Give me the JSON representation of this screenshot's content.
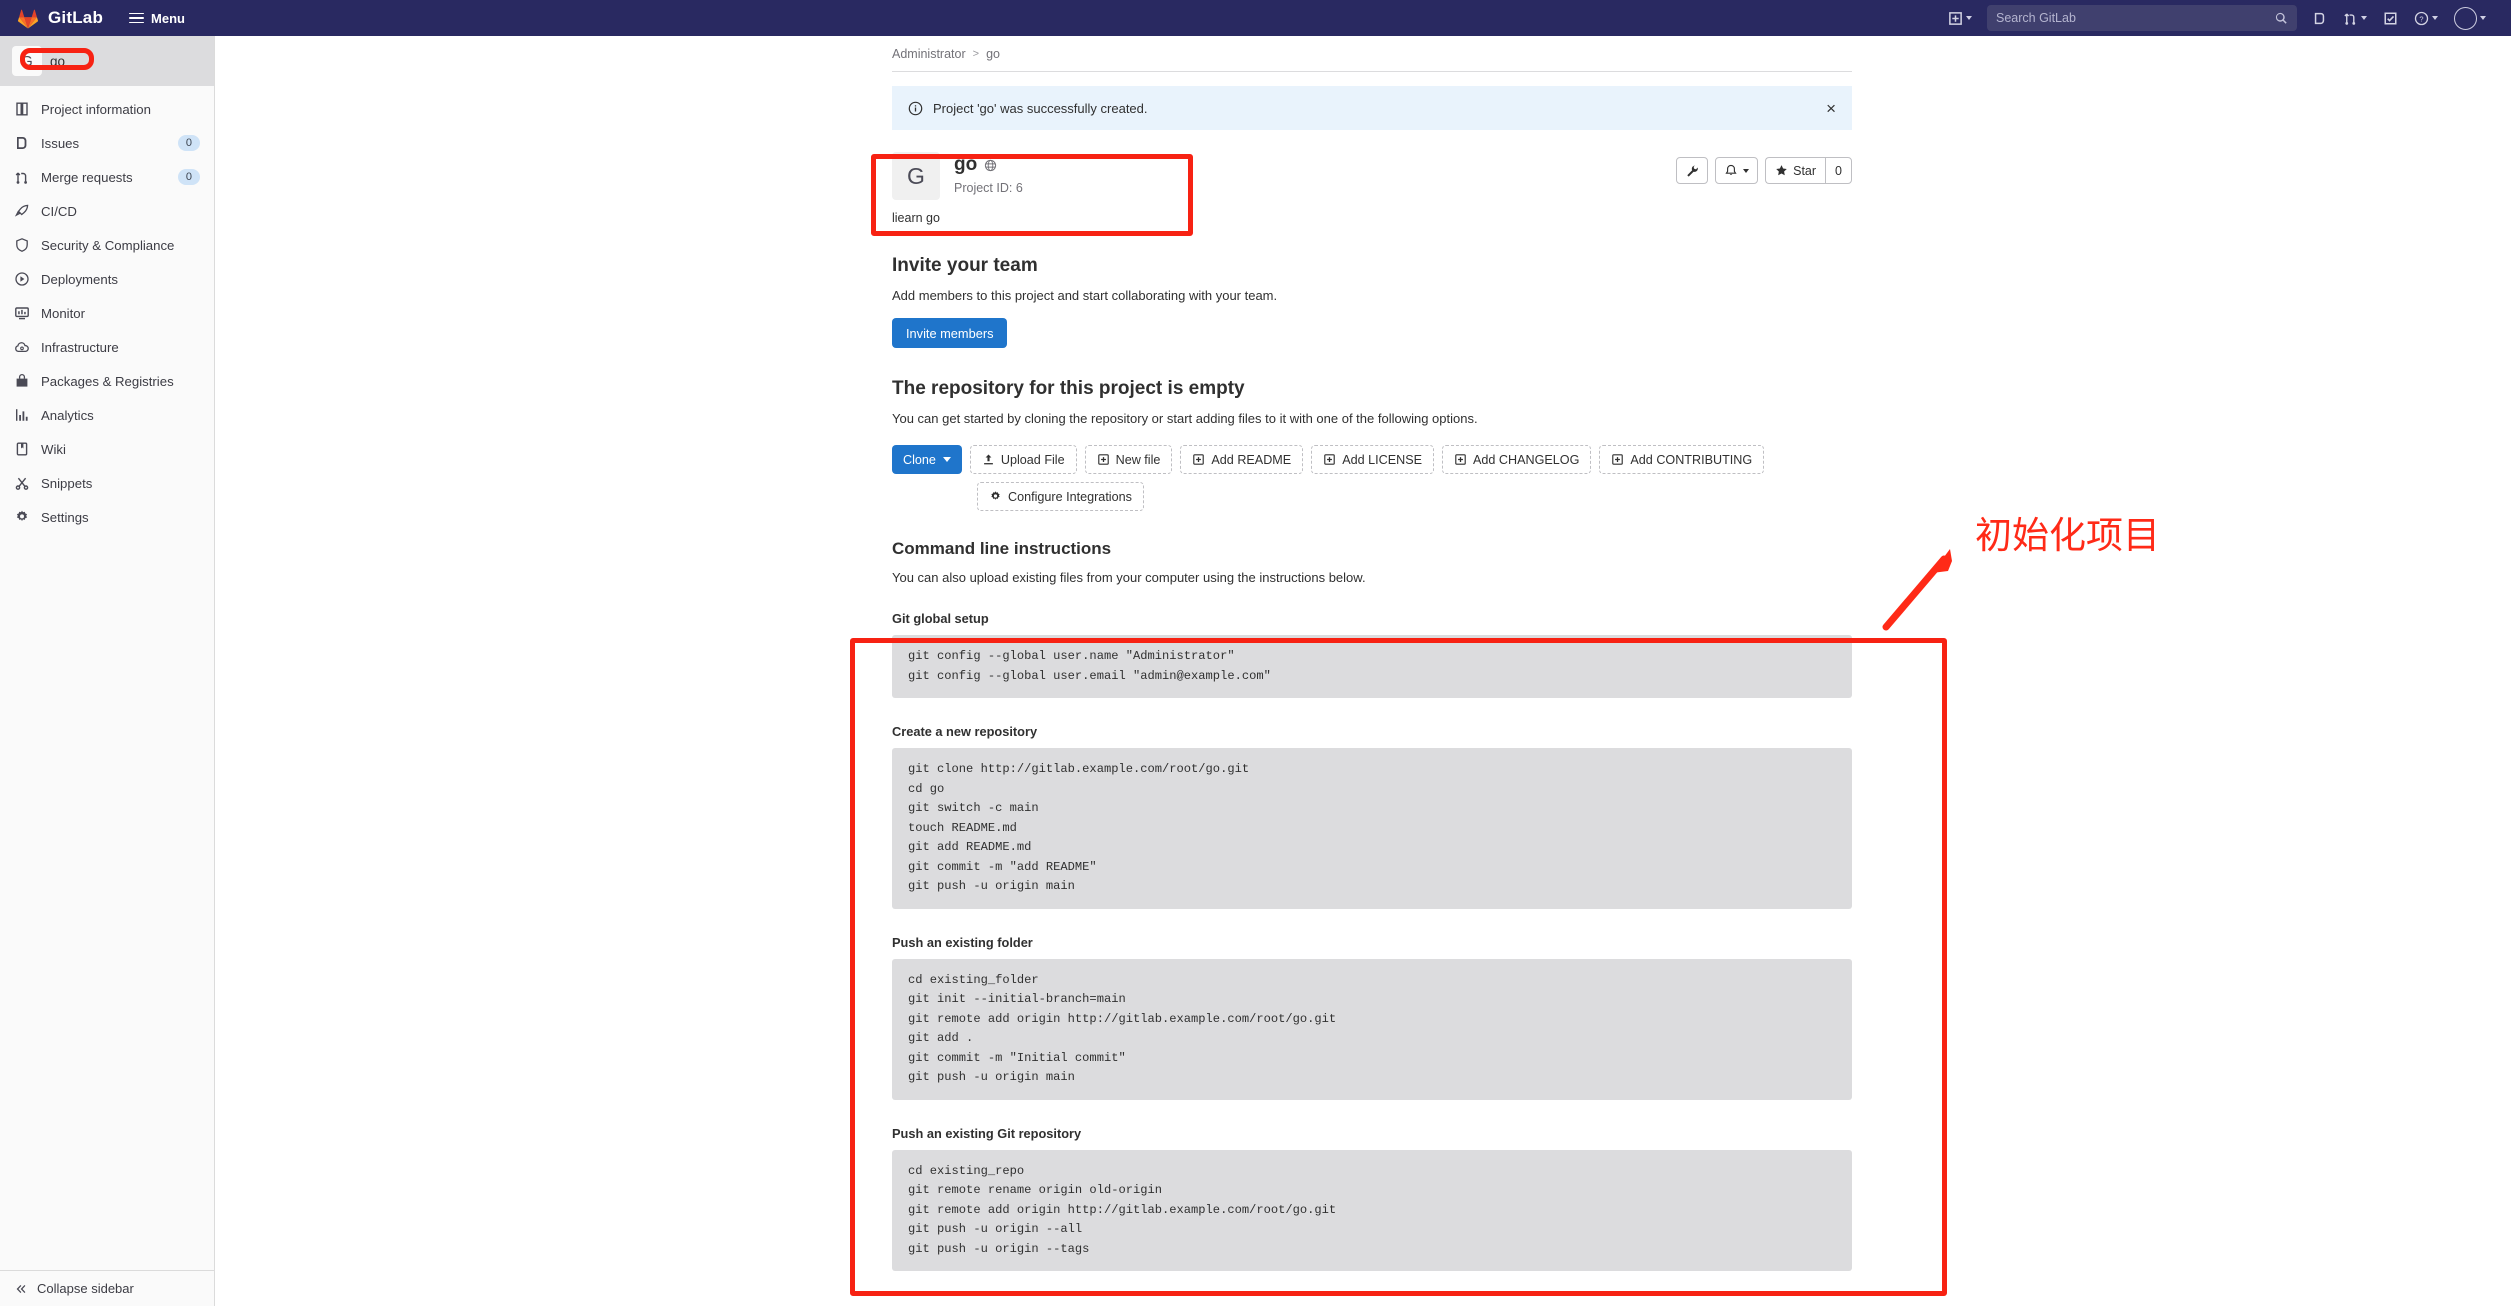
{
  "topnav": {
    "brand": "GitLab",
    "menu_label": "Menu",
    "brand_icon": "gitlab-logo-icon",
    "plus_icon": "plus-square-icon",
    "search_placeholder": "Search GitLab",
    "search_value": "",
    "search_icon": "search-icon",
    "issues_icon": "issues-icon",
    "merge_requests_icon": "merge-request-icon",
    "todos_icon": "todo-checkbox-icon",
    "help_icon": "question-circle-icon",
    "avatar_icon": "user-avatar-icon"
  },
  "sidebar": {
    "project": {
      "avatar_letter": "G",
      "name": "go"
    },
    "items": [
      {
        "label": "Project information",
        "icon": "project-information-icon",
        "badge": ""
      },
      {
        "label": "Issues",
        "icon": "issues-icon",
        "badge": "0"
      },
      {
        "label": "Merge requests",
        "icon": "merge-request-icon",
        "badge": "0"
      },
      {
        "label": "CI/CD",
        "icon": "rocket-icon",
        "badge": ""
      },
      {
        "label": "Security & Compliance",
        "icon": "shield-icon",
        "badge": ""
      },
      {
        "label": "Deployments",
        "icon": "deployments-icon",
        "badge": ""
      },
      {
        "label": "Monitor",
        "icon": "monitor-icon",
        "badge": ""
      },
      {
        "label": "Infrastructure",
        "icon": "cloud-gear-icon",
        "badge": ""
      },
      {
        "label": "Packages & Registries",
        "icon": "package-icon",
        "badge": ""
      },
      {
        "label": "Analytics",
        "icon": "chart-bar-icon",
        "badge": ""
      },
      {
        "label": "Wiki",
        "icon": "book-icon",
        "badge": ""
      },
      {
        "label": "Snippets",
        "icon": "scissors-icon",
        "badge": ""
      },
      {
        "label": "Settings",
        "icon": "gear-icon",
        "badge": ""
      }
    ],
    "collapse_label": "Collapse sidebar",
    "collapse_icon": "chevron-double-left-icon"
  },
  "breadcrumb": {
    "root": "Administrator",
    "separator": ">",
    "current": "go"
  },
  "alert": {
    "icon": "info-circle-icon",
    "message": "Project 'go' was successfully created.",
    "close_icon": "close-icon",
    "close_label": "×"
  },
  "project": {
    "avatar_letter": "G",
    "title": "go",
    "visibility_icon": "globe-icon",
    "project_id": "Project ID: 6",
    "description": "liearn go",
    "actions": {
      "wrench_icon": "wrench-icon",
      "notification_icon": "bell-icon",
      "star_icon": "star-icon",
      "star_label": "Star",
      "star_count": "0"
    }
  },
  "invite": {
    "heading": "Invite your team",
    "description": "Add members to this project and start collaborating with your team.",
    "button": "Invite members"
  },
  "empty_repo": {
    "heading": "The repository for this project is empty",
    "description": "You can get started by cloning the repository or start adding files to it with one of the following options.",
    "clone_label": "Clone",
    "buttons": [
      {
        "label": "Upload File",
        "icon": "upload-icon"
      },
      {
        "label": "New file",
        "icon": "new-file-icon"
      },
      {
        "label": "Add README",
        "icon": "new-file-icon"
      },
      {
        "label": "Add LICENSE",
        "icon": "new-file-icon"
      },
      {
        "label": "Add CHANGELOG",
        "icon": "new-file-icon"
      },
      {
        "label": "Add CONTRIBUTING",
        "icon": "new-file-icon"
      }
    ],
    "integrations": {
      "label": "Configure Integrations",
      "icon": "gear-icon"
    }
  },
  "cli": {
    "heading": "Command line instructions",
    "description": "You can also upload existing files from your computer using the instructions below.",
    "blocks": [
      {
        "title": "Git global setup",
        "code": "git config --global user.name \"Administrator\"\ngit config --global user.email \"admin@example.com\""
      },
      {
        "title": "Create a new repository",
        "code": "git clone http://gitlab.example.com/root/go.git\ncd go\ngit switch -c main\ntouch README.md\ngit add README.md\ngit commit -m \"add README\"\ngit push -u origin main"
      },
      {
        "title": "Push an existing folder",
        "code": "cd existing_folder\ngit init --initial-branch=main\ngit remote add origin http://gitlab.example.com/root/go.git\ngit add .\ngit commit -m \"Initial commit\"\ngit push -u origin main"
      },
      {
        "title": "Push an existing Git repository",
        "code": "cd existing_repo\ngit remote rename origin old-origin\ngit remote add origin http://gitlab.example.com/root/go.git\ngit push -u origin --all\ngit push -u origin --tags"
      }
    ]
  },
  "annotations": {
    "color": "#f72213",
    "note_text": "初始化项目",
    "boxes": [
      {
        "name": "sidebar-project-highlight"
      },
      {
        "name": "project-header-highlight"
      },
      {
        "name": "cli-instructions-highlight"
      }
    ]
  }
}
